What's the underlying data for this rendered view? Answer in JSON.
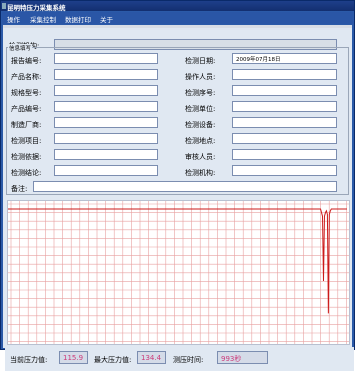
{
  "window": {
    "title": "昆明特压力采集系统"
  },
  "menu": [
    "操作",
    "采集控制",
    "数据打印",
    "关于"
  ],
  "form": {
    "group_label": "信息填写",
    "agency_label": "检测机构:",
    "fields": {
      "report_no": {
        "label": "报告编号:",
        "value": ""
      },
      "product_name": {
        "label": "产品名称:",
        "value": ""
      },
      "model": {
        "label": "规格型号:",
        "value": ""
      },
      "product_no": {
        "label": "产品编号:",
        "value": ""
      },
      "manufacturer": {
        "label": "制造厂商:",
        "value": ""
      },
      "test_item": {
        "label": "检测项目:",
        "value": ""
      },
      "test_basis": {
        "label": "检测依据:",
        "value": ""
      },
      "test_conclusion": {
        "label": "检测结论:",
        "value": ""
      },
      "remarks": {
        "label": "备注:",
        "value": ""
      },
      "test_date": {
        "label": "检测日期:",
        "value": "2009年07月18日"
      },
      "operator": {
        "label": "操作人员:",
        "value": ""
      },
      "test_seq": {
        "label": "检测序号:",
        "value": ""
      },
      "test_unit": {
        "label": "检测单位:",
        "value": ""
      },
      "test_device": {
        "label": "检测设备:",
        "value": ""
      },
      "test_place": {
        "label": "检测地点:",
        "value": ""
      },
      "reviewer": {
        "label": "审核人员:",
        "value": ""
      },
      "test_agency": {
        "label": "检测机构:",
        "value": ""
      }
    }
  },
  "chart_data": {
    "type": "line",
    "series": [
      {
        "values": [
          0,
          0,
          0,
          0,
          0,
          0,
          0,
          0,
          0,
          0,
          0,
          0,
          0,
          0,
          0,
          0,
          0,
          0,
          0,
          0,
          0,
          0,
          0,
          0,
          0,
          0,
          0,
          0,
          0,
          0,
          0,
          0,
          0,
          0,
          0,
          0,
          0,
          0,
          0,
          0,
          0,
          0,
          0,
          0,
          0,
          0,
          0,
          0,
          0,
          0,
          0,
          0,
          0,
          0,
          0,
          0,
          0,
          0,
          0,
          0,
          0,
          0,
          0,
          0,
          0,
          0,
          0,
          0,
          0,
          0,
          0,
          0,
          0,
          0,
          0,
          0,
          0,
          0,
          0,
          0,
          0,
          0,
          0,
          0,
          0,
          0,
          0,
          0,
          0,
          0,
          0,
          0,
          0,
          0,
          0,
          0,
          0,
          0,
          0,
          0,
          0,
          0,
          0,
          0,
          0,
          0,
          0,
          0,
          0,
          0,
          0,
          0,
          0,
          0,
          0,
          0,
          0,
          0,
          0,
          0,
          0,
          0,
          0,
          0,
          0,
          0,
          0,
          0,
          0,
          0,
          0,
          0,
          0,
          0,
          0,
          0,
          0,
          0,
          0,
          0,
          0,
          0,
          0,
          0,
          0,
          0,
          0,
          0,
          0,
          0,
          0,
          0,
          0,
          0,
          0,
          0,
          0,
          0,
          0,
          0,
          0,
          0,
          0,
          0,
          0,
          0,
          0,
          0,
          0,
          0,
          0,
          0,
          0,
          0,
          0,
          0,
          0,
          0,
          0,
          0,
          0,
          0,
          0,
          0,
          0,
          0,
          0,
          0,
          0,
          0,
          0,
          0,
          0,
          0,
          0,
          0,
          0,
          0,
          0,
          0,
          0,
          0,
          0,
          0,
          0,
          0,
          0,
          0,
          0,
          0,
          0,
          0,
          0,
          0,
          0,
          0,
          0,
          0,
          0,
          0,
          0,
          0,
          0,
          0,
          0,
          0,
          0,
          0,
          0,
          0,
          0,
          0,
          0,
          0,
          0,
          0,
          0,
          0,
          0,
          0,
          0,
          0,
          0,
          0,
          0,
          0,
          0,
          0,
          0,
          0,
          0,
          0,
          0,
          0,
          0,
          0,
          0,
          0,
          0,
          0,
          0,
          0,
          0,
          0,
          0,
          0,
          0,
          0,
          0,
          0,
          0,
          0,
          0,
          0,
          0,
          0,
          0,
          0,
          0,
          0,
          0,
          0,
          0,
          0,
          0,
          0,
          0,
          0,
          0,
          0,
          0,
          0,
          0,
          0,
          0,
          0,
          0,
          0,
          0,
          0,
          0,
          0,
          0,
          0,
          0,
          0,
          0,
          0,
          0,
          0,
          0,
          0,
          0,
          0,
          0,
          0,
          0,
          0,
          0,
          0,
          -2,
          -4,
          -40,
          -4,
          -2,
          -1,
          -3,
          -58,
          -3,
          -1,
          0,
          0,
          0,
          0,
          0,
          0,
          0,
          0,
          0,
          0,
          0,
          0,
          0,
          0,
          0,
          0,
          0
        ]
      }
    ],
    "grid": true,
    "colors": {
      "grid": "#e8a0a0",
      "line": "#cc1a1a"
    }
  },
  "footer": {
    "current_label": "当前压力值:",
    "current_value": "115.9",
    "max_label": "最大压力值:",
    "max_value": "134.4",
    "time_label": "测压时间:",
    "time_value": "993秒"
  }
}
